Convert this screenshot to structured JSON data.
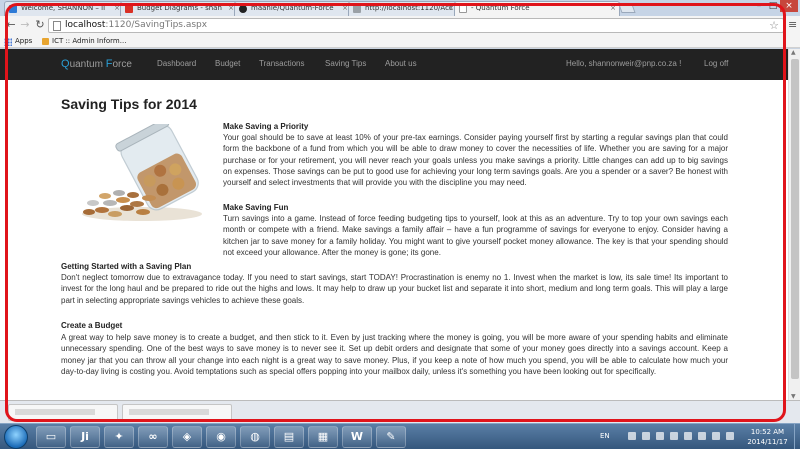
{
  "browser": {
    "tabs": [
      {
        "title": "Welcome, SHANNON – li",
        "favicon_color": "#2d7ad6"
      },
      {
        "title": "Budget Diagrams - shan",
        "favicon_color": "#d93025"
      },
      {
        "title": "maanie/Quantum-Force",
        "favicon_color": "#222222"
      },
      {
        "title": "http://localhost:1120/Acc",
        "favicon_color": "#9aa0a6"
      },
      {
        "title": "- Quantum Force",
        "favicon_color": "#9aa0a6"
      }
    ],
    "url_host": "localhost",
    "url_path": ":1120/SavingTips.aspx",
    "bookmarks": [
      {
        "label": "Apps",
        "icon": "apps-grid-icon"
      },
      {
        "label": "ICT :: Admin Inform...",
        "icon": "bookmark-icon"
      }
    ]
  },
  "site": {
    "brand_q": "Q",
    "brand_rest1": "uantum ",
    "brand_f": "F",
    "brand_rest2": "orce",
    "nav": [
      "Dashboard",
      "Budget",
      "Transactions",
      "Saving Tips",
      "About us"
    ],
    "greeting": "Hello, shannonweir@pnp.co.za !",
    "logoff": "Log off"
  },
  "content": {
    "title": "Saving Tips for 2014",
    "sections": [
      {
        "heading": "Make Saving a Priority",
        "body": "Your goal should be to save at least 10% of your pre-tax earnings. Consider paying yourself first by starting a regular savings plan that could form the backbone of a fund from which you will be able to draw money to cover the necessities of life. Whether you are saving for a major purchase or for your retirement, you will never reach your goals unless you make savings a priority. Little changes can add up to big savings on expenses. Those savings can be put to good use for achieving your long term savings goals. Are you a spender or a saver? Be honest with yourself and select investments that will provide you with the discipline you may need."
      },
      {
        "heading": "Make Saving Fun",
        "body": "Turn savings into a game. Instead of force feeding budgeting tips to yourself, look at this as an adventure. Try to top your own savings each month or compete with a friend. Make savings a family affair – have a fun programme of savings for everyone to enjoy. Consider having a kitchen jar to save money for a family holiday. You might want to give yourself pocket money allowance. The key is that your spending should not exceed your allowance. After the money is gone; its gone."
      },
      {
        "heading": "Getting Started with a Saving Plan",
        "body": "Don't neglect tomorrow due to extravagance today. If you need to start savings, start TODAY! Procrastination is enemy no 1. Invest when the market is low, its sale time! Its important to invest for the long haul and be prepared to ride out the highs and lows. It may help to draw up your bucket list and separate it into short, medium and long term goals. This will play a large part in selecting appropriate savings vehicles to achieve these goals."
      },
      {
        "heading": "Create a Budget",
        "body": "A great way to help save money is to create a budget, and then stick to it. Even by just tracking where the money is going, you will be more aware of your spending habits and eliminate unnecessary spending. One of the best ways to save money is to never see it. Set up debit orders and designate that some of your money goes directly into a savings account. Keep a money jar that you can throw all your change into each night is a great way to save money. Plus, if you keep a note of how much you spend, you will be able to calculate how much your day-to-day living is costing you. Avoid temptations such as special offers popping into your mailbox daily, unless it's something you have been looking out for specifically."
      }
    ]
  },
  "taskbar": {
    "language": "EN",
    "time": "10:52 AM",
    "date": "2014/11/17"
  },
  "colors": {
    "accent": "#2a9fd6",
    "navbar": "#222222",
    "highlight": "#e0141b"
  }
}
